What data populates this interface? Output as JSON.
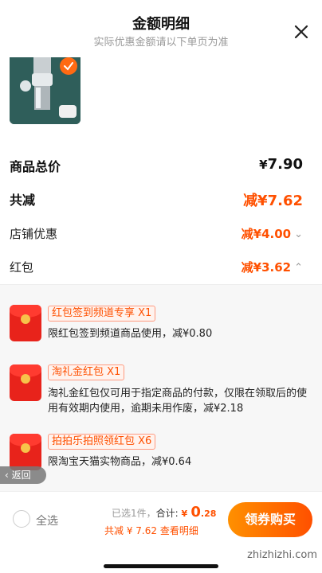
{
  "header": {
    "title": "金额明细",
    "subtitle": "实际优惠金额请以下单页为准"
  },
  "summary": {
    "total_label": "商品总价",
    "total_currency": "¥",
    "total_value": "7.90",
    "reduce_label": "共减",
    "reduce_value": "减¥7.62",
    "shop_label": "店铺优惠",
    "shop_value": "减¥4.00",
    "redpacket_label": "红包",
    "redpacket_value": "减¥3.62"
  },
  "redpackets": [
    {
      "tag": "红包签到频道专享 X1",
      "desc": "限红包签到频道商品使用，减¥0.80"
    },
    {
      "tag": "淘礼金红包 X1",
      "desc": "淘礼金红包仅可用于指定商品的付款，仅限在领取后的使用有效期内使用，逾期未用作废，减¥2.18"
    },
    {
      "tag": "拍拍乐拍照领红包 X6",
      "desc": "限淘宝天猫实物商品，减¥0.64"
    }
  ],
  "back_label": "返回",
  "bottom_bar": {
    "select_all": "全选",
    "selected": "已选1件，",
    "total_label": "合计:",
    "price_currency": "¥",
    "price_int": "0",
    "price_dec": ".28",
    "reduce_text": "共减 ¥ 7.62",
    "detail_link": "查看明细",
    "buy_label": "领券购买"
  },
  "watermark": "zhizhizhi.com",
  "colors": {
    "accent": "#ff5000",
    "redpacket": "#e8231b",
    "product_bg": "#2f5e5a"
  }
}
